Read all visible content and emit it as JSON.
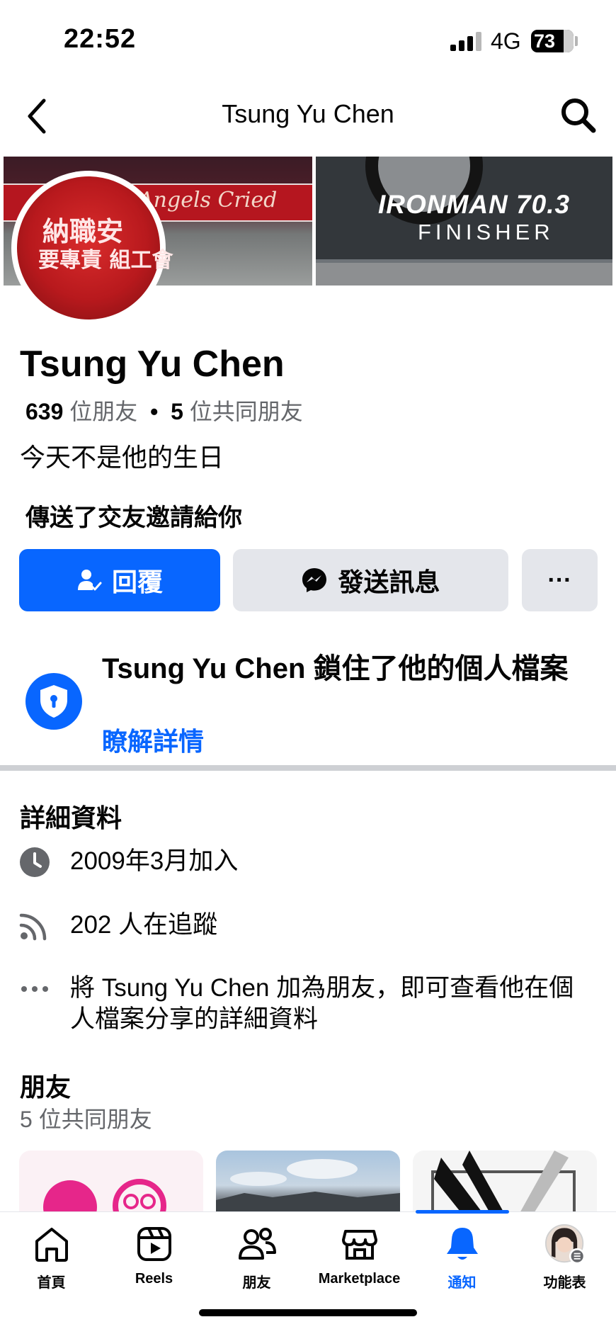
{
  "status_bar": {
    "time": "22:52",
    "network": "4G",
    "battery": "73"
  },
  "nav": {
    "title": "Tsung Yu Chen"
  },
  "cover": {
    "left_banner_text": "Angels Cried",
    "right_line1": "IRONMAN 70.3",
    "right_line2": "FINISHER",
    "avatar_line1": "納職安",
    "avatar_line2": "要專責 組工會"
  },
  "profile": {
    "name": "Tsung Yu Chen",
    "friend_count": "639",
    "friend_count_label": "位朋友",
    "separator": "•",
    "mutual_count": "5",
    "mutual_label": "位共同朋友",
    "birthday_note": "今天不是他的生日",
    "request_note": "傳送了交友邀請給你"
  },
  "actions": {
    "reply_label": "回覆",
    "message_label": "發送訊息",
    "more_label": "···"
  },
  "locked": {
    "text": "Tsung Yu Chen 鎖住了他的個人檔案",
    "learn_more": "瞭解詳情"
  },
  "details": {
    "title": "詳細資料",
    "items": [
      {
        "icon": "clock-icon",
        "text": "2009年3月加入"
      },
      {
        "icon": "rss-follow-icon",
        "text": "202 人在追蹤"
      },
      {
        "icon": "more-dots-icon",
        "text": "將 Tsung Yu Chen 加為朋友，即可查看他在個人檔案分享的詳細資料"
      }
    ]
  },
  "friends": {
    "title": "朋友",
    "subtitle": "5 位共同朋友"
  },
  "tabbar": {
    "active": "通知",
    "items": [
      {
        "icon": "home-icon",
        "label": "首頁"
      },
      {
        "icon": "reels-icon",
        "label": "Reels"
      },
      {
        "icon": "friends-icon",
        "label": "朋友"
      },
      {
        "icon": "marketplace-icon",
        "label": "Marketplace"
      },
      {
        "icon": "bell-icon",
        "label": "通知"
      },
      {
        "icon": "menu-avatar-icon",
        "label": "功能表"
      }
    ]
  },
  "colors": {
    "accent": "#0866ff",
    "secondary_button": "#e4e6eb",
    "muted_text": "#65676b",
    "divider": "#ced0d4"
  }
}
